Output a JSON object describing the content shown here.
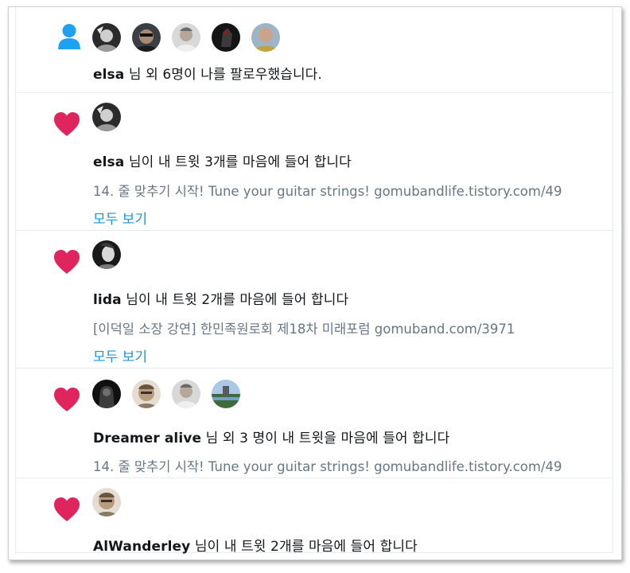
{
  "colors": {
    "heart": "#e0245e",
    "follow": "#1da1f2",
    "link": "#1b95e0",
    "muted": "#657786"
  },
  "notifications": [
    {
      "type": "follow",
      "icon": "person-icon",
      "user": "elsa",
      "text": "님 외 6명이 나를 팔로우했습니다."
    },
    {
      "type": "like",
      "icon": "heart-icon",
      "user": "elsa",
      "text": "님이 내 트윗 3개를 마음에 들어 합니다",
      "tweet": "14. 줄 맞추기 시작! Tune your guitar strings! gomubandlife.tistory.com/49",
      "more": "모두 보기"
    },
    {
      "type": "like",
      "icon": "heart-icon",
      "user": "lida",
      "text": "님이 내 트윗 2개를 마음에 들어 합니다",
      "tweet": "[이덕일 소장 강연] 한민족원로회 제18차 미래포럼 gomuband.com/3971",
      "more": "모두 보기"
    },
    {
      "type": "like",
      "icon": "heart-icon",
      "user": "Dreamer alive",
      "text": "님 외 3 명이 내 트윗을 마음에 들어 합니다",
      "tweet": "14. 줄 맞추기 시작! Tune your guitar strings! gomubandlife.tistory.com/49"
    },
    {
      "type": "like",
      "icon": "heart-icon",
      "user": "AlWanderley",
      "text": "님이 내 트윗 2개를 마음에 들어 합니다"
    }
  ]
}
